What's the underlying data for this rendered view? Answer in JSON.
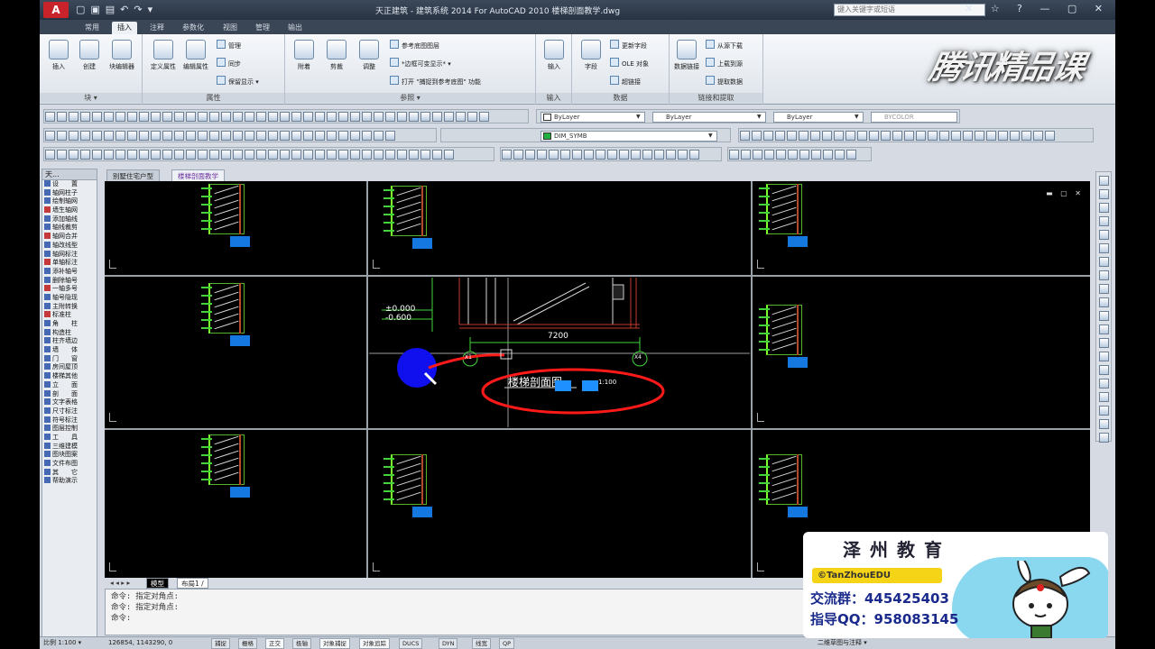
{
  "app": {
    "title": "天正建筑 - 建筑系统 2014  For AutoCAD 2010    楼梯剖面教学.dwg",
    "search_placeholder": "键入关键字或短语",
    "logo_letter": "A"
  },
  "ribbon_tabs": [
    "常用",
    "插入",
    "注释",
    "参数化",
    "视图",
    "管理",
    "输出"
  ],
  "active_tab_index": 1,
  "ribbon": {
    "block_group": {
      "label": "块 ▾",
      "buttons": [
        "插入",
        "创建",
        "块编辑器"
      ]
    },
    "attr_group": {
      "label": "属性",
      "buttons": [
        "定义属性",
        "编辑属性"
      ],
      "small": [
        "管理",
        "同步",
        "保留显示 ▾"
      ]
    },
    "ref_group": {
      "label": "参照 ▾",
      "buttons": [
        "附着",
        "剪裁",
        "调整"
      ],
      "small": [
        "参考底图图层",
        "*边框可变显示* ▾",
        "打开  \"捕捉到参考底图\" 功能"
      ]
    },
    "import_group": {
      "label": "输入",
      "buttons": [
        "输入"
      ]
    },
    "data_group": {
      "label": "数据",
      "buttons": [
        "字段"
      ],
      "small": [
        "更新字段",
        "OLE 对象",
        "超链接"
      ]
    },
    "link_group": {
      "label": "链接和提取",
      "buttons": [
        "数据链接"
      ],
      "small": [
        "从源下载",
        "上载到源",
        "提取数据"
      ]
    }
  },
  "watermark": "腾讯精品课",
  "toolbars": {
    "layer_combo": "ByLayer",
    "linetype_combo": "ByLayer",
    "lineweight_combo": "ByLayer",
    "plotstyle_combo": "BYCOLOR",
    "layer_name": "DIM_SYMB"
  },
  "left_panel": {
    "title": "天...",
    "items": [
      "设　　置",
      "轴网柱子",
      "绘制轴网",
      "墙生轴网",
      "添加轴线",
      "轴线裁剪",
      "轴网合并",
      "轴改线型",
      "轴网标注",
      "单轴标注",
      "添补轴号",
      "删除轴号",
      "一轴多号",
      "轴号隐现",
      "主附转换",
      "标准柱",
      "角　　柱",
      "构造柱",
      "柱齐墙边",
      "墙　　体",
      "门　　窗",
      "房间屋顶",
      "楼梯其他",
      "立　　面",
      "剖　　面",
      "文字表格",
      "尺寸标注",
      "符号标注",
      "图层控制",
      "工　　具",
      "三维建模",
      "图块图案",
      "文件布图",
      "其　　它",
      "帮助演示"
    ]
  },
  "doc_tabs": [
    "别墅住宅户型",
    "楼梯剖面教学"
  ],
  "active_doc_tab": 1,
  "drawing": {
    "elev1": "±0.000",
    "elev2": "-0.600",
    "dim": "7200",
    "axis1": "X1",
    "axis2": "X4",
    "section_label": "楼梯剖面图",
    "scale": "1:100"
  },
  "layout_tabs": {
    "model": "模型",
    "layout": "布局1 /"
  },
  "command_lines": [
    "命令:  指定对角点:",
    "命令:  指定对角点:",
    "命令:"
  ],
  "status": {
    "scale": "比例 1:100 ▾",
    "coords": "126854, 1143290, 0",
    "buttons": [
      "捕捉",
      "栅格",
      "正交",
      "极轴",
      "对象捕捉",
      "对象追踪",
      "DUCS",
      "DYN",
      "线宽",
      "QP"
    ],
    "right": "二维草图与注释 ▾"
  },
  "promo": {
    "brand": "泽州教育",
    "tag": "©TanZhouEDU",
    "line1": "交流群：445425403",
    "line2": "指导QQ：958083145"
  },
  "colors": {
    "accent": "#1478e0",
    "cad_bg": "#000000",
    "ribbon": "#dde3ea"
  }
}
